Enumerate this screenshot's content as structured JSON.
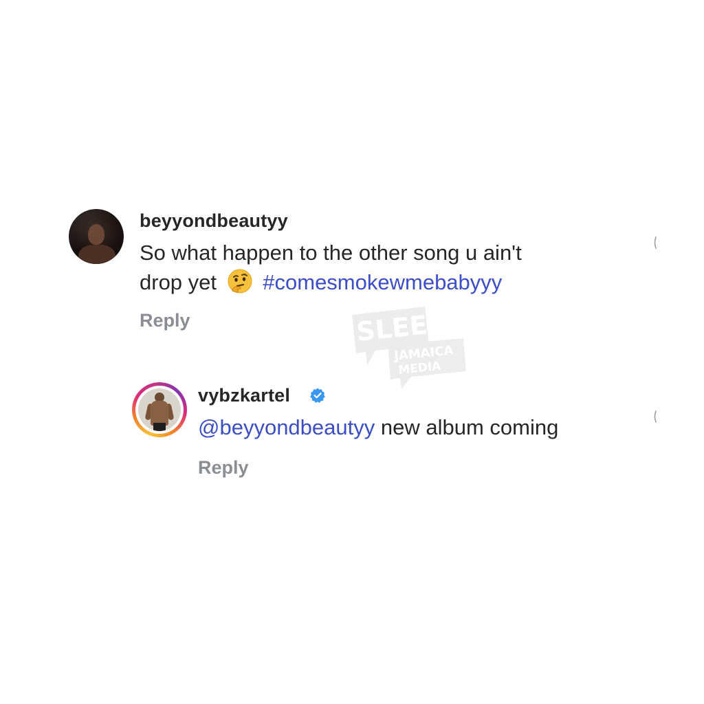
{
  "watermark": {
    "line1": "SLEEK",
    "line2": "JAMAICA",
    "line3": "MEDIA"
  },
  "comment_1": {
    "username": "beyyondbeautyy",
    "text_line1": "So what happen to the other song u ain't",
    "text_line2_prefix": "drop yet",
    "emoji": "thinking-face-emoji",
    "hashtag": "#comesmokewmebabyyy",
    "reply_label": "Reply"
  },
  "comment_2": {
    "username": "vybzkartel",
    "verified": true,
    "mention": "@beyyondbeautyy",
    "text": " new album coming",
    "reply_label": "Reply"
  },
  "colors": {
    "link_blue": "#3c4ec7",
    "reply_gray": "#8a8d93",
    "verified_blue": "#3897f0",
    "text_dark": "#262626"
  }
}
